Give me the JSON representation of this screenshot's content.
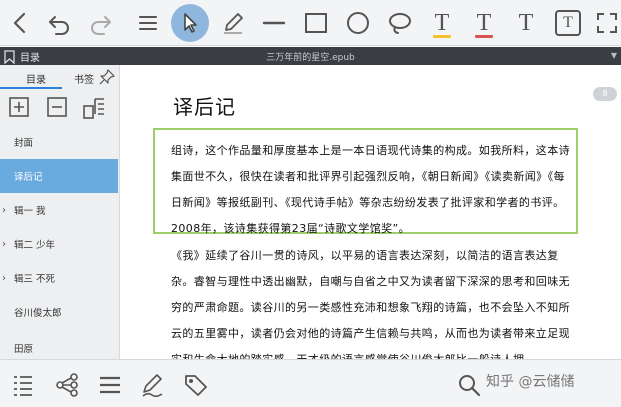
{
  "toolbar": {
    "items": [
      {
        "icon": "back-chevron-icon"
      },
      {
        "icon": "undo-icon"
      },
      {
        "icon": "redo-icon"
      },
      {
        "icon": "menu-icon"
      },
      {
        "icon": "pointer-icon",
        "active": true
      },
      {
        "icon": "pencil-icon"
      },
      {
        "icon": "line-icon"
      },
      {
        "icon": "rectangle-icon"
      },
      {
        "icon": "circle-icon"
      },
      {
        "icon": "lasso-icon"
      },
      {
        "icon": "text-highlight-icon",
        "glyph": "T",
        "underline_color": "#f2c12e"
      },
      {
        "icon": "text-underline-icon",
        "glyph": "T",
        "underline_color": "#d9534f"
      },
      {
        "icon": "text-icon",
        "glyph": "T"
      },
      {
        "icon": "text-box-icon",
        "glyph": "T"
      },
      {
        "icon": "fullscreen-icon"
      }
    ],
    "active_color": "#8fb7de"
  },
  "titlebar": {
    "section_label": "目录",
    "filename": "三万年前的星空.epub"
  },
  "sidebar": {
    "tabs": [
      "目录",
      "书签"
    ],
    "toc": [
      {
        "label": "封面",
        "expandable": false,
        "selected": false
      },
      {
        "label": "译后记",
        "expandable": false,
        "selected": true
      },
      {
        "label": "辑一  我",
        "expandable": true,
        "selected": false
      },
      {
        "label": "辑二  少年",
        "expandable": true,
        "selected": false
      },
      {
        "label": "辑三  不死",
        "expandable": true,
        "selected": false
      },
      {
        "label": "谷川俊太郎",
        "expandable": false,
        "selected": false
      },
      {
        "label": "田原",
        "expandable": false,
        "selected": false
      }
    ],
    "selected_color": "#6aabdf"
  },
  "reader": {
    "page_number": "8",
    "heading": "译后记",
    "highlighted_paragraph": "组诗，这个作品量和厚度基本上是一本日语现代诗集的构成。如我所料，这本诗集面世不久，很快在读者和批评界引起强烈反响，《朝日新闻》《读卖新闻》《每日新闻》等报纸副刊、《现代诗手帖》等杂志纷纷发表了批评家和学者的书评。2008年，该诗集获得第23届“诗歌文学馆奖”。",
    "paragraph": "《我》延续了谷川一贯的诗风，以平易的语言表达深刻，以简洁的语言表达复杂。睿智与理性中透出幽默，自嘲与自省之中又为读者留下深深的思考和回味无穷的严肃命题。读谷川的另一类感性充沛和想象飞翔的诗篇，也不会坠入不知所云的五里雾中，读者仍会对他的诗篇产生信赖与共鸣，从而也为读者带来立足现实和生命大地的踏实感。天才级的语言感觉使谷川俊太郎比一般诗人拥",
    "highlight_border_color": "#9ccf6a"
  },
  "bottombar": {
    "items": [
      {
        "icon": "toc-list-icon"
      },
      {
        "icon": "mindmap-icon"
      },
      {
        "icon": "list-icon"
      },
      {
        "icon": "signature-icon"
      },
      {
        "icon": "tag-icon"
      },
      {
        "icon": "search-icon"
      }
    ],
    "watermark": "知乎 @云储储"
  }
}
